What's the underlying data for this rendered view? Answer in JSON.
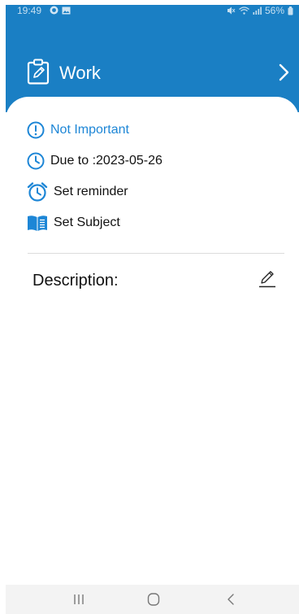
{
  "status_bar": {
    "time": "19:49",
    "battery": "56%",
    "icons": [
      "whatsapp-icon",
      "gallery-icon",
      "mute-icon",
      "wifi-icon",
      "signal-icon",
      "battery-icon"
    ]
  },
  "header": {
    "title": "Work",
    "icon": "clipboard-edit-icon",
    "next_icon": "chevron-right-icon"
  },
  "details": {
    "importance": "Not Important",
    "due": "Due to :2023-05-26",
    "reminder": "Set reminder",
    "subject": "Set Subject"
  },
  "description": {
    "label": "Description:",
    "edit_icon": "pencil-icon"
  },
  "colors": {
    "header_bg": "#1a7fc4",
    "accent_blue": "#1d86d6",
    "nav_bg": "#f3f3f3"
  },
  "nav": [
    "recent-apps-icon",
    "home-icon",
    "back-icon"
  ]
}
